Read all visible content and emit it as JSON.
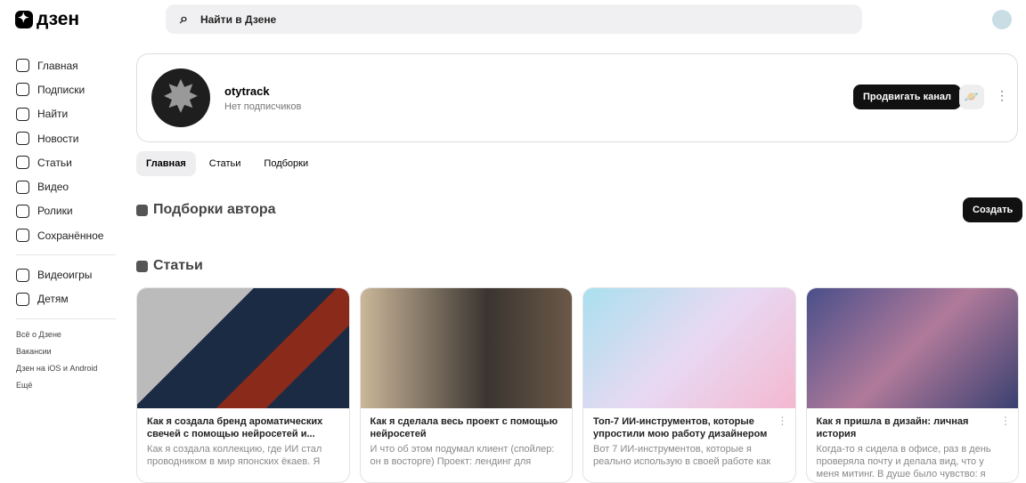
{
  "header": {
    "logo": "дзен",
    "search_placeholder": "Найти в Дзене"
  },
  "sidebar": {
    "items": [
      {
        "label": "Главная",
        "icon": "home-icon"
      },
      {
        "label": "Подписки",
        "icon": "subscriptions-icon"
      },
      {
        "label": "Найти",
        "icon": "search-icon"
      },
      {
        "label": "Новости",
        "icon": "news-icon"
      },
      {
        "label": "Статьи",
        "icon": "articles-icon"
      },
      {
        "label": "Видео",
        "icon": "video-icon"
      },
      {
        "label": "Ролики",
        "icon": "shorts-icon"
      },
      {
        "label": "Сохранённое",
        "icon": "bookmark-icon"
      }
    ],
    "extra": [
      {
        "label": "Видеоигры",
        "icon": "gamepad-icon"
      },
      {
        "label": "Детям",
        "icon": "kids-icon"
      }
    ],
    "links": [
      "Всё о Дзене",
      "Вакансии",
      "Дзен на iOS и Android",
      "Ещё"
    ]
  },
  "channel": {
    "name": "otytrack",
    "subscribers": "Нет подписчиков",
    "promote": "Продвигать канал"
  },
  "tabs": [
    "Главная",
    "Статьи",
    "Подборки"
  ],
  "sections": {
    "collections": "Подборки автора",
    "create": "Создать",
    "articles": "Статьи"
  },
  "articles": [
    {
      "title": "Как я создала бренд ароматических свечей с помощью нейросетей и...",
      "desc": "Как я создала коллекцию, где ИИ стал проводником в мир японских ёкаев. Я"
    },
    {
      "title": "Как я сделала весь проект с помощью нейросетей",
      "desc": "И что об этом подумал клиент (спойлер: он в восторге) Проект: лендинг для"
    },
    {
      "title": "Топ-7 ИИ-инструментов, которые упростили мою работу дизайнером",
      "desc": "Вот 7 ИИ-инструментов, которые я реально использую в своей работе как"
    },
    {
      "title": "Как я пришла в дизайн: личная история",
      "desc": "Когда-то я сидела в офисе, раз в день проверяла почту и делала вид, что у меня митинг. В душе было чувство: я"
    }
  ]
}
